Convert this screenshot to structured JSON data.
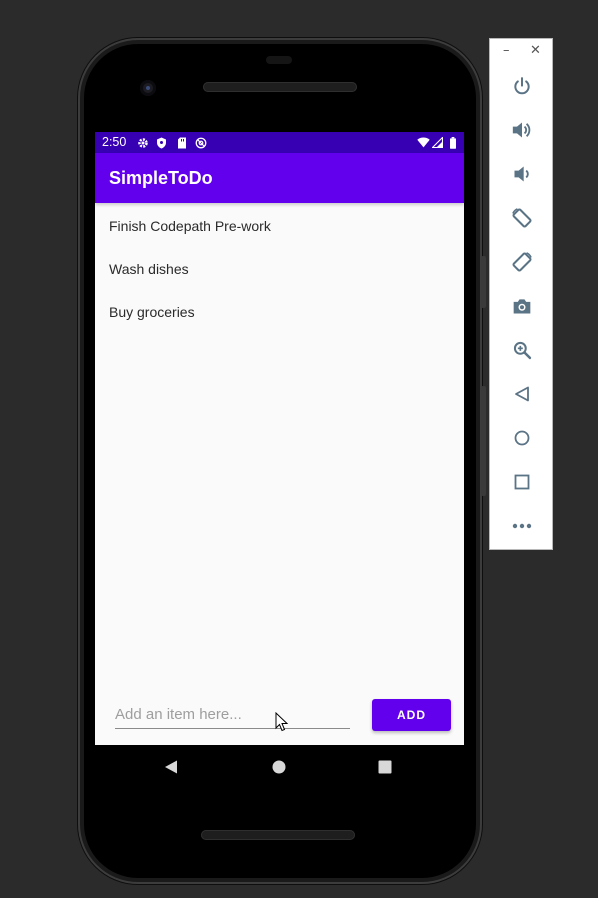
{
  "status_bar": {
    "time": "2:50",
    "icons": [
      "settings-icon",
      "shield-icon",
      "sd-card-icon",
      "at-sign-icon",
      "wifi-icon",
      "signal-icon",
      "battery-icon"
    ]
  },
  "app_bar": {
    "title": "SimpleToDo"
  },
  "todo_list": {
    "items": [
      {
        "label": "Finish Codepath Pre-work"
      },
      {
        "label": "Wash dishes"
      },
      {
        "label": "Buy groceries"
      }
    ]
  },
  "input": {
    "placeholder": "Add an item here...",
    "value": ""
  },
  "add_button": {
    "label": "ADD"
  },
  "nav_bar": {
    "buttons": [
      "back-icon",
      "home-icon",
      "recents-icon"
    ]
  },
  "emulator_toolbar": {
    "window_controls": {
      "minimize": "–",
      "close": "✕"
    },
    "buttons": [
      "power-icon",
      "volume-up-icon",
      "volume-down-icon",
      "rotate-left-icon",
      "rotate-right-icon",
      "camera-icon",
      "zoom-icon",
      "back-icon",
      "home-icon",
      "overview-icon",
      "more-icon"
    ]
  },
  "colors": {
    "primary": "#6200ee",
    "primary_dark": "#3700b3",
    "background": "#fafafa",
    "desktop": "#2b2b2b",
    "toolbar_icon": "#5a7385"
  }
}
